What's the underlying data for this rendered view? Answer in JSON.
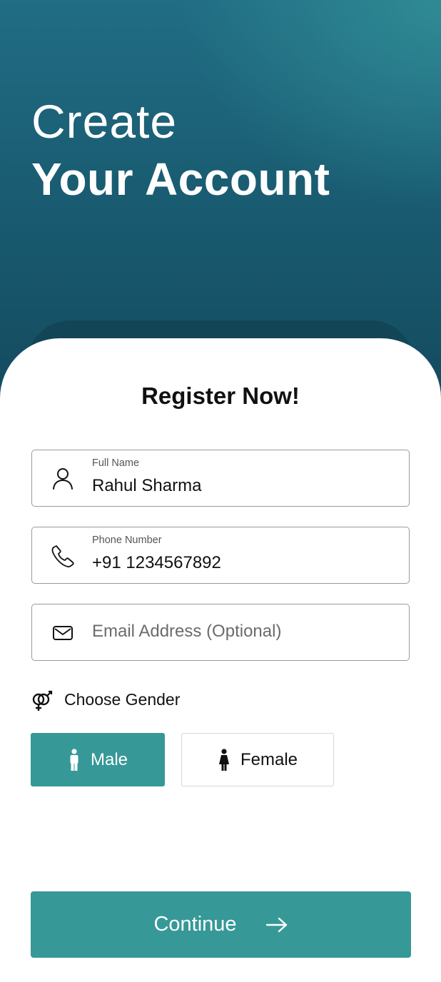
{
  "header": {
    "title_line1": "Create",
    "title_line2": "Your Account"
  },
  "form": {
    "heading": "Register Now!",
    "full_name": {
      "label": "Full Name",
      "value": "Rahul Sharma",
      "icon": "user-icon"
    },
    "phone": {
      "label": "Phone Number",
      "value": "+91 1234567892",
      "icon": "phone-icon"
    },
    "email": {
      "placeholder": "Email Address (Optional)",
      "icon": "mail-icon"
    },
    "gender": {
      "label": "Choose Gender",
      "icon": "gender-icon",
      "options": [
        {
          "label": "Male",
          "icon": "male-icon",
          "selected": true
        },
        {
          "label": "Female",
          "icon": "female-icon",
          "selected": false
        }
      ]
    },
    "continue_label": "Continue"
  },
  "colors": {
    "accent": "#379898",
    "header_dark": "#144b5f",
    "header_light": "#2f8a94"
  }
}
